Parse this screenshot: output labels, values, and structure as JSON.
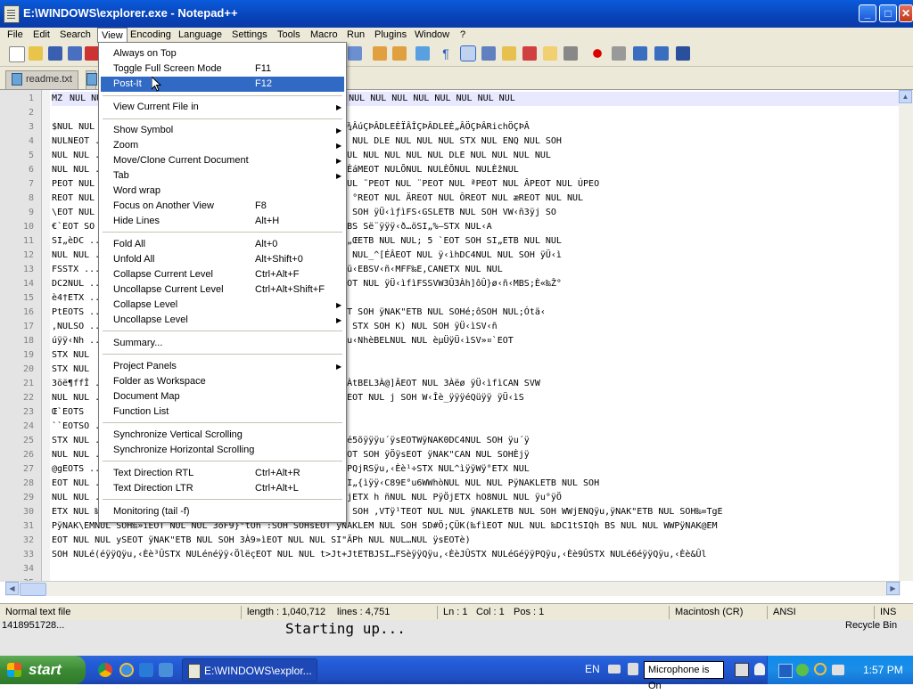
{
  "window": {
    "title": "E:\\WINDOWS\\explorer.exe - Notepad++"
  },
  "menubar": [
    "File",
    "Edit",
    "Search",
    "View",
    "Encoding",
    "Language",
    "Settings",
    "Tools",
    "Macro",
    "Run",
    "Plugins",
    "Window",
    "?"
  ],
  "tabs": {
    "active": "readme.txt"
  },
  "view_menu": {
    "always_on_top": "Always on Top",
    "toggle_full_screen": "Toggle Full Screen Mode",
    "toggle_full_screen_sc": "F11",
    "post_it": "Post-It",
    "post_it_sc": "F12",
    "view_current_file_in": "View Current File in",
    "show_symbol": "Show Symbol",
    "zoom": "Zoom",
    "move_clone": "Move/Clone Current Document",
    "tab": "Tab",
    "word_wrap": "Word wrap",
    "focus_other_view": "Focus on Another View",
    "focus_other_view_sc": "F8",
    "hide_lines": "Hide Lines",
    "hide_lines_sc": "Alt+H",
    "fold_all": "Fold All",
    "fold_all_sc": "Alt+0",
    "unfold_all": "Unfold All",
    "unfold_all_sc": "Alt+Shift+0",
    "collapse_current": "Collapse Current Level",
    "collapse_current_sc": "Ctrl+Alt+F",
    "uncollapse_current": "Uncollapse Current Level",
    "uncollapse_current_sc": "Ctrl+Alt+Shift+F",
    "collapse_level": "Collapse Level",
    "uncollapse_level": "Uncollapse Level",
    "summary": "Summary...",
    "project_panels": "Project Panels",
    "folder_as_workspace": "Folder as Workspace",
    "document_map": "Document Map",
    "function_list": "Function List",
    "sync_vertical": "Synchronize Vertical Scrolling",
    "sync_horizontal": "Synchronize Horizontal Scrolling",
    "text_dir_rtl": "Text Direction RTL",
    "text_dir_rtl_sc": "Ctrl+Alt+R",
    "text_dir_ltr": "Text Direction LTR",
    "text_dir_ltr_sc": "Ctrl+Alt+L",
    "monitoring": "Monitoring (tail -f)"
  },
  "editor": {
    "line_numbers": [
      "1",
      "2",
      "3",
      "4",
      "5",
      "6",
      "7",
      "8",
      "9",
      "10",
      "11",
      "12",
      "13",
      "14",
      "15",
      "16",
      "17",
      "18",
      "19",
      "20",
      "21",
      "22",
      "23",
      "24",
      "25",
      "26",
      "27",
      "28",
      "29",
      "30",
      "31",
      "32",
      "33",
      "34",
      "35"
    ],
    "lines": [
      "MZNUL NUL NUL NUL NUL@NUL NUL NUL NUL NUL NUL NUL NUL NUL NUL NUL NUL NUL NUL NUL NUL",
      "",
      "$NUL NUL  ...  DLEÈÑÂ×ÇÞÂÖÇßÂHÂPÂDLEÈfÂÈÇÞÂDLEÈÈÂÖÇÞÂDLEÈ¾ÂúÇÞÂDLEÈÏÂÎÇÞÂDLEÈ„ÂÖÇÞÂRichÖÇÞÂ",
      "NULNEOT  ...  NUL NUL DLE NUL NUL NUL@EOT NUL NUL NUL SOH NUL DLE NUL NUL NUL STX NUL ENQ NUL SOH",
      "NUL NUL  ...  DLE NUL STX NUL NUL ÈNUL NUL EOT NUL NUL àNUL NUL NUL NUL NUL DLE NUL NUL NUL NUL",
      "NUL NUL  ...  MEOT NULÎMEOT NULáNUL NULÆPSOH NULÈ„NUL NULÈáMEOT NULÕNUL NULÈÕNUL NULÈžNUL",
      "PEOT NUL  ...  NUL \\PEOT NUL nPEOT NUL | PEOT NUL ŠPEOT NUL ˜PEOT NUL ¨PEOT NUL ªPEOT NUL ÂPEOT NUL ÚPEO",
      "REOT NUL  ...  NUL hREOT NUL zREOT NUL REOT NUL žREOT NUL °REOT NUL ÄREOT NUL ÔREOT NUL æREOT NUL NUL",
      "\\EOT NUL  ...  `NUL SOH÷¤SOH SOH | SUB NUL SOH DLE US NUL SOH ÿÜ‹ìƒìFS‹GSLETB NUL SOH VW‹ñ3ÿj SO",
      "€`EOT SO  ...  TX NUL FF»ÎNUL NUL NUL ;ÇSI„RUS SOH NUL ‹]BS Së¨ÿÿÿ‹ð…öSI„%–STX NUL‹A",
      "SI„èDC  ...  ³,ENQ NUL NUL SI„rÈNUL NUL; ³(ENQ NUL NUL SI„ŒETB NUL NUL; 5 `EOT SOH SI„ETB NUL NUL",
      "NUL NUL  ...  ÜSI†ÑÍNUL NUL ÈNAK SI…˜ÛSOH NUL ÈFF NUL NUL NUL_^[ÉÂEOT NUL ÿ‹ìhDC4NUL NUL SOH ÿÜ‹ì",
      "FSSTX  ...  Ì NUL SOHè NUL SOH ÿÜ‹ìfìp;€`EOT SOH S‹]DLE¾Eü‹EBSV‹ñ‹MFF‰E,CANETX NUL NUL",
      "DC2NUL  ...  ETB NUL NUL ETX NUL NUL 9BS SI…ŽMSTX NUL^]ÂEOT NUL ÿÜ‹ìfìFSSVW3Û3Àh]ôÛ}ø‹ñ‹MBS;È«‰Ž°",
      "è4†ETX  ...  ETB NUL SOH f…À|0ÿNAKÃCAN NUL SOH",
      "PtEOTS  ...  ÔB‹~T;ûuUS;ÕuETX‰FTSSħEOT ENQ NUL NUL ÿ5\"`EOT SOH ÿNAK\"ETB NUL SOHé;ôSOH NUL;Ótä‹",
      ",NULSO  ...  NUL SOH%) NUL SOH 5) NUL SOH ESC STX SOH ESC STX SOH K) NUL SOH ÿÜ‹ìSV‹ñ",
      "úÿÿ‹Nh  ...  SI„BELÞSOH NUL_^[]ÂEOT NUL W‹ÎèuÿÿÿéÍþÿÿÿVQÿu‹NhèBELNUL NUL èµÜÿÜ‹ìSV»¤`EOT",
      "STX NUL",
      "STX NUL",
      "3öë¶ffÎ  ...  tSUB; ENQŒ`EOT SOH tDC2Pÿ NAK éCAN NUL SOH…ÀtBEL3À@]ÂEOT NUL 3Àëø ÿÜ‹ìfìCAN SVW",
      "NUL NUL  ...  BS NUL ÿÜ‹ìVÿuBS‹ñè ûÿÿjSOHj NULP‹Îè»õÿÿ^]ÂEOT NUL j SOH W‹Îè_ÿÿÿéQüÿÿ ÿÜ‹ìS",
      "Œ`EOTS",
      "``EOTSO  ...  ÿV‹ñf~DLE NUL SI…Í",
      "STX NUL  ...  ‹M,é\"õÿÿ‹STX M`QÛ|ÿÿÿQRÿPDLE…ÀSI,Íõÿÿ‹E^‹M,é5õÿÿÿu´ÿsEOTWÿNAK0DC4NUL SOH ÿu´ÿ",
      "NUL NUL  ...  ‹EèÌSTX NUL‹5DLE CAN NUL SOH WÿsEOTÿÖWÿ5Œ`EOT SOH ÿÖÿsEOT ÿNAK\"CAN NUL SOHÈjÿ",
      "@gEOTS  ...  NUL WÿNAKæCAN NUL SOH PÿNAKèSYN NUL SOHéÂþÿÿPQjRSÿu,‹Èè¹÷STX NUL^ìÿÿWÿ°ETX NUL",
      "EOT NUL  ...  NUL NUL SOH NUL NUL STX ÿNAK DC3 NUL SOH…ÀSI„{ìÿÿ‹C89E°u6WWhòNUL NUL NUL PÿNAKLETB NUL SOH",
      "NUL NUL  ...  HWÿu,ÿNAKìCAN NUL SOH;Ç‰E°t|‹5øCAN NUL SOH jETX h ñNUL NUL PÿÖjETX hO8NUL NUL ÿu°ÿÖ",
      "ETX NUL ‰E¨ëSIëÿÿ‰DC4EOT NUL NUL ‰{CAN9=`EOT SOH uDC1Wj SOH ,VTÿ¹TEOT NUL NUL ÿNAKLETB NUL SOH WWjENQÿu,ÿNAK\"ETB NUL SOH‰=TgE",
      "PÿNAK\\EMNUL SOH‰»ìEOT NUL NUL 3öF9}°tOh`:SOH SOHsEOT ÿNAKLEM NUL SOH SD#Ö;ÇÜK(‰fìEOT NUL NUL ‰DC1tSIQh BS NUL NUL WWPÿNAK@EM",
      "EOT NUL NUL ySEOT ÿNAK\"ETB NUL SOH 3À9»ìEOT NUL NUL SI\"ÄPh NUL NUL…NUL ÿsEOTè)",
      "SOH NULé(éÿÿQÿu,‹Èè³ÛSTX NULénéÿÿ‹ÖlëçEOT NUL NUL t>Jt+JtETBJSI…FSèÿÿQÿu,‹ÈèJÛSTX NULéGéÿÿPQÿu,‹Èè9ÛSTX NULé6éÿÿQÿu,‹Èè&Ûl",
      "",
      ""
    ]
  },
  "statusbar": {
    "file_type": "Normal text file",
    "length": "length : 1,040,712",
    "lines": "lines : 4,751",
    "ln": "Ln : 1",
    "col": "Col : 1",
    "pos": "Pos : 1",
    "eol": "Macintosh (CR)",
    "encoding": "ANSI",
    "mode": "INS"
  },
  "desktop": {
    "left_text": "1418951728...",
    "center_text": "Starting up...",
    "right_text": "Recycle Bin"
  },
  "taskbar": {
    "start": "start",
    "task_item": "E:\\WINDOWS\\explor...",
    "lang": "EN",
    "mic": "Microphone is On",
    "clock": "1:57 PM"
  }
}
